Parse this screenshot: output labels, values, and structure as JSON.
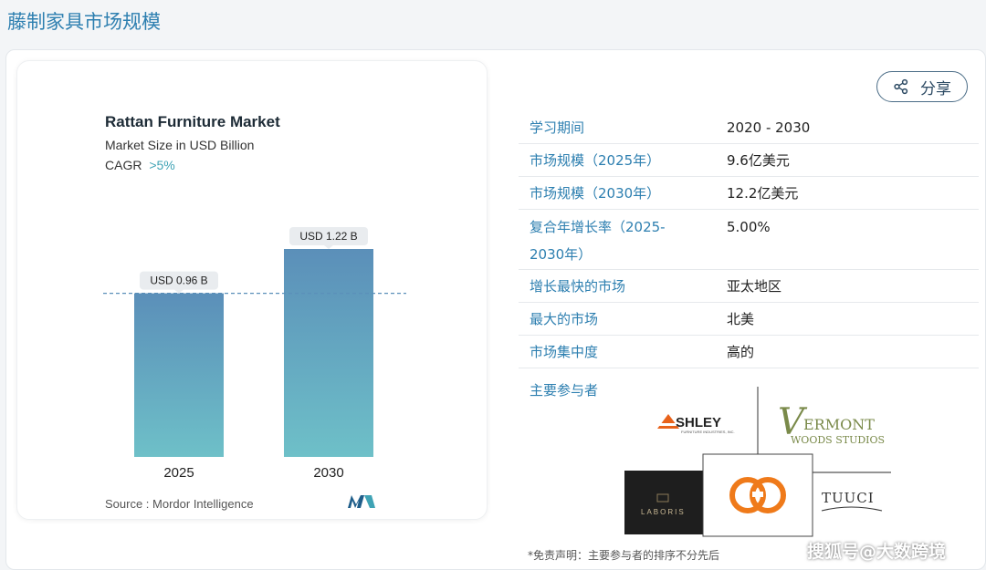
{
  "page": {
    "title": "藤制家具市场规模"
  },
  "share": {
    "label": "分享",
    "icon": "share-icon"
  },
  "chart_data": {
    "type": "bar",
    "title": "Rattan Furniture Market",
    "subtitle": "Market Size in USD Billion",
    "cagr_label": "CAGR",
    "cagr_value": ">5%",
    "categories": [
      "2025",
      "2030"
    ],
    "values": [
      0.96,
      1.22
    ],
    "data_labels": [
      "USD 0.96 B",
      "USD 1.22 B"
    ],
    "source": "Source : Mordor Intelligence",
    "ylim": [
      0,
      1.3
    ],
    "reference_line_value": 0.96,
    "colors": {
      "bar_top": "#5b8fb9",
      "bar_bottom": "#6ec0c8",
      "accent": "#3fa3b5"
    }
  },
  "table": {
    "rows": [
      {
        "key": "学习期间",
        "value": "2020 - 2030"
      },
      {
        "key": "市场规模（2025年）",
        "value": "9.6亿美元"
      },
      {
        "key": "市场规模（2030年）",
        "value": "12.2亿美元"
      },
      {
        "key": "复合年增长率（2025-2030年）",
        "value": "5.00%"
      },
      {
        "key": "增长最快的市场",
        "value": "亚太地区"
      },
      {
        "key": "最大的市场",
        "value": "北美"
      },
      {
        "key": "市场集中度",
        "value": "高的"
      }
    ]
  },
  "players": {
    "title": "主要参与者",
    "logos": {
      "ashley_main": "SHLEY",
      "ashley_sub": "FURNITURE INDUSTRIES, INC.",
      "vermont_main": "ERMONT",
      "vermont_sub": "WOODS STUDIOS",
      "laboris": "LABORIS",
      "tuuci": "TUUCI"
    }
  },
  "disclaimer": "*免责声明：主要参与者的排序不分先后",
  "watermark": "搜狐号@大数跨境"
}
